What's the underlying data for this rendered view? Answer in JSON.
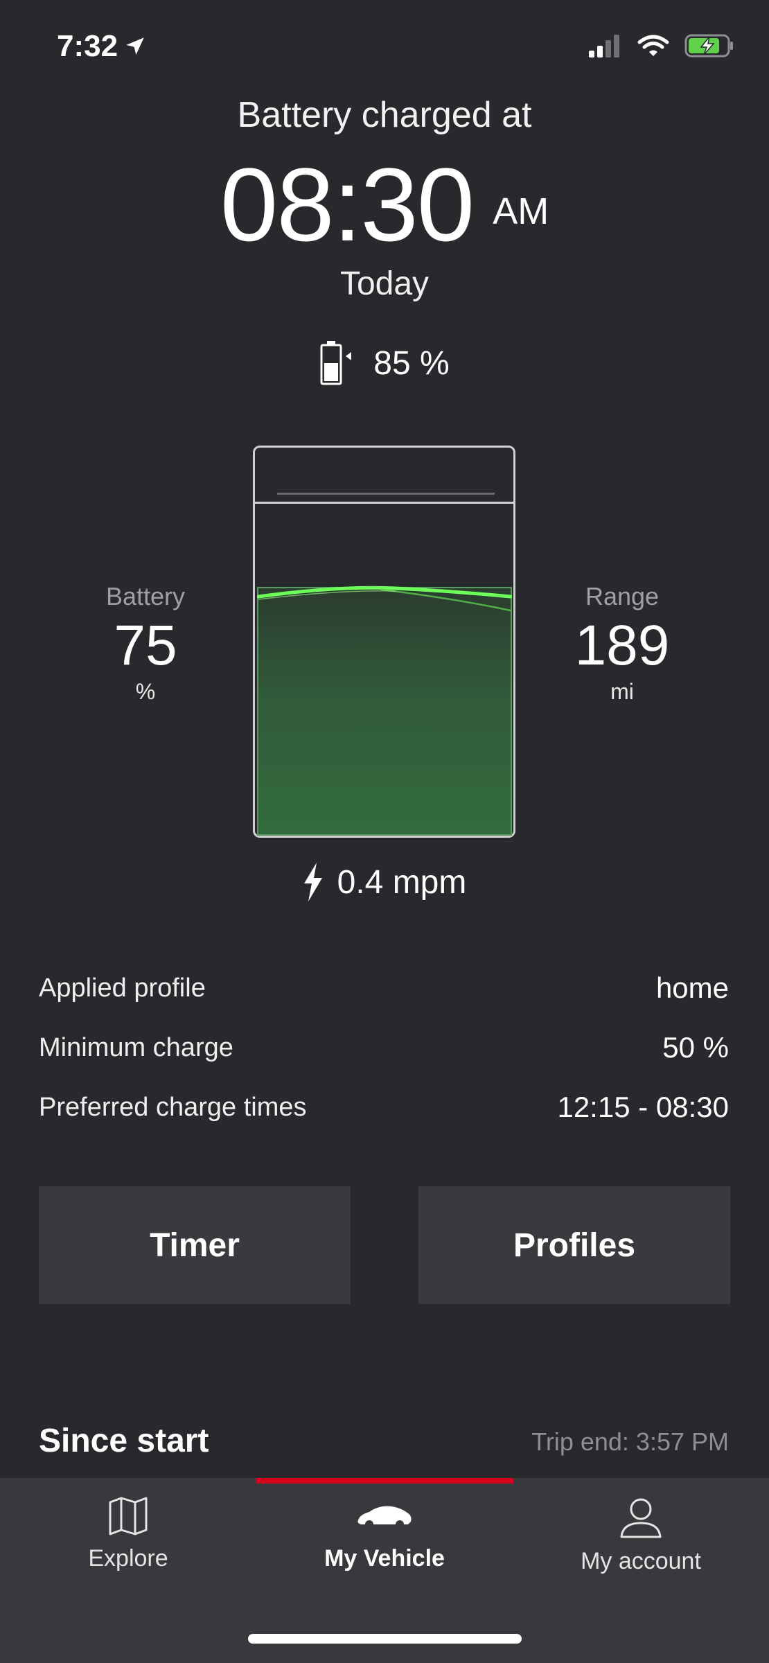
{
  "status_bar": {
    "time": "7:32"
  },
  "header": {
    "title": "Battery charged at",
    "time": "08:30",
    "ampm": "AM",
    "day": "Today",
    "target_percent": "85 %"
  },
  "battery": {
    "label": "Battery",
    "value": "75",
    "unit": "%",
    "level_fraction": 0.75
  },
  "range": {
    "label": "Range",
    "value": "189",
    "unit": "mi"
  },
  "charge_rate": "0.4 mpm",
  "info": [
    {
      "key": "Applied profile",
      "value": "home"
    },
    {
      "key": "Minimum charge",
      "value": "50 %"
    },
    {
      "key": "Preferred charge times",
      "value": "12:15 - 08:30"
    }
  ],
  "buttons": {
    "timer": "Timer",
    "profiles": "Profiles"
  },
  "trip": {
    "section_title": "Since start",
    "trip_end": "Trip end: 3:57 PM"
  },
  "tabs": [
    {
      "label": "Explore",
      "icon": "map-icon"
    },
    {
      "label": "My Vehicle",
      "icon": "car-icon",
      "active": true
    },
    {
      "label": "My account",
      "icon": "user-icon"
    }
  ],
  "colors": {
    "background": "#28292d",
    "accent_red": "#d5001c",
    "charge_green": "#6dff5a"
  }
}
